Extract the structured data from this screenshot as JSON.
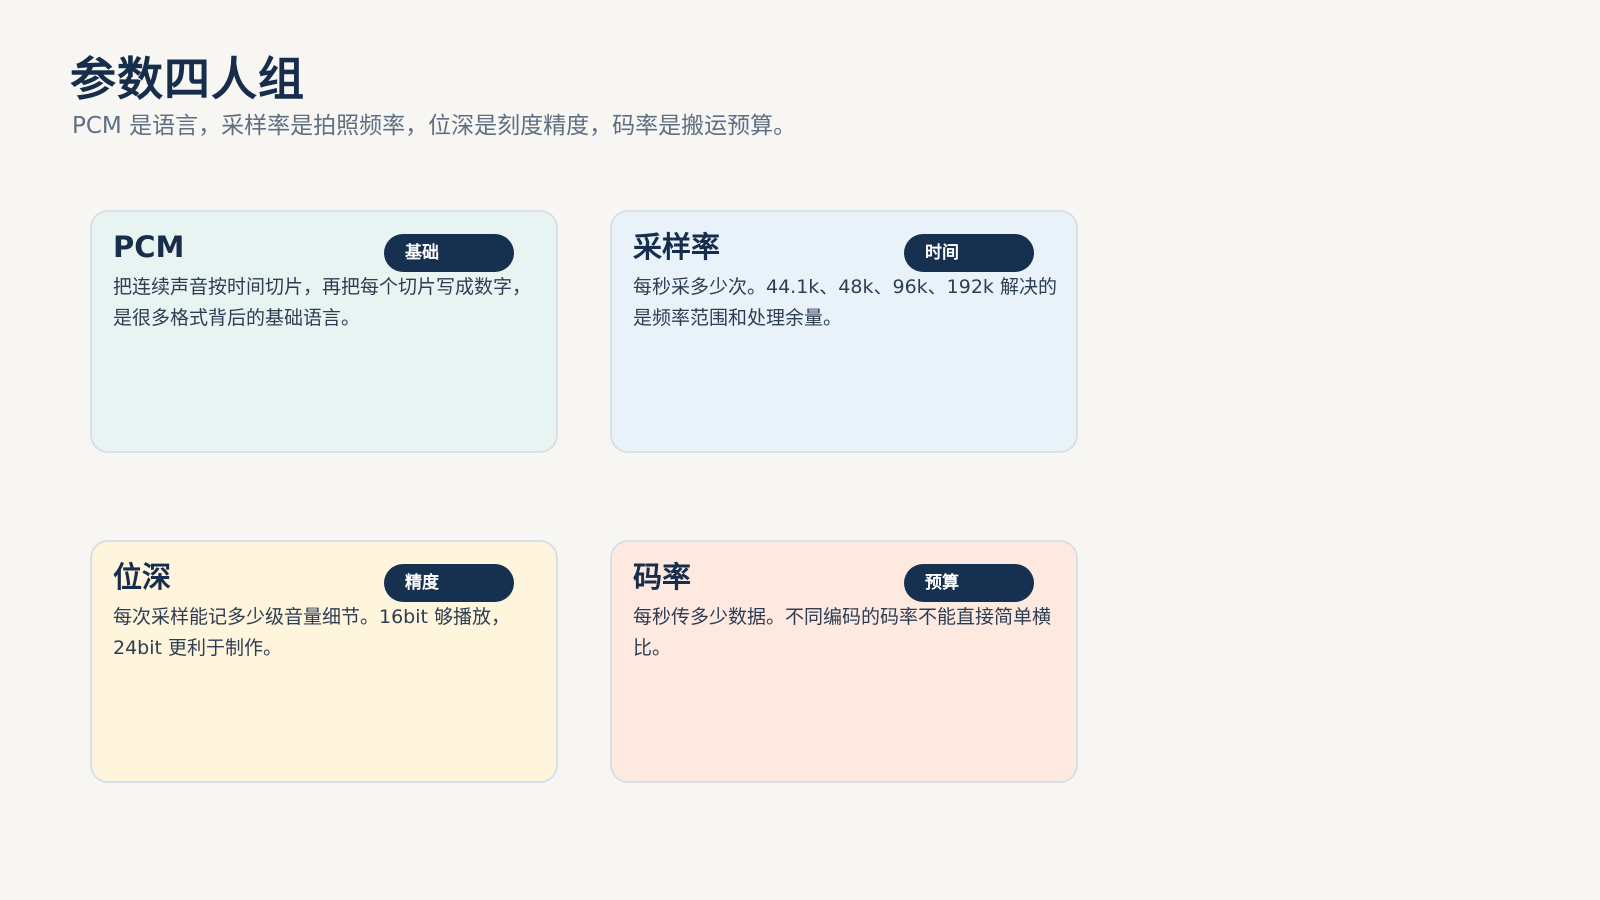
{
  "page": {
    "title": "参数四人组",
    "subtitle": "PCM 是语言，采样率是拍照频率，位深是刻度精度，码率是搬运预算。"
  },
  "cards": [
    {
      "title": "PCM",
      "tag": "基础",
      "description": "把连续声音按时间切片，再把每个切片写成数字，是很多格式背后的基础语言。",
      "background": "#e7f4f1"
    },
    {
      "title": "采样率",
      "tag": "时间",
      "description": "每秒采多少次。44.1k、48k、96k、192k 解决的是频率范围和处理余量。",
      "background": "#e8f2f8"
    },
    {
      "title": "位深",
      "tag": "精度",
      "description": "每次采样能记多少级音量细节。16bit 够播放，24bit 更利于制作。",
      "background": "#fff4dc"
    },
    {
      "title": "码率",
      "tag": "预算",
      "description": "每秒传多少数据。不同编码的码率不能直接简单横比。",
      "background": "#fee9e1"
    }
  ],
  "colors": {
    "page_background": "#f7f6f2",
    "heading": "#172d4c",
    "tag_background": "#16304f",
    "tag_text": "#ffffff",
    "subtitle": "#5f6f83"
  }
}
